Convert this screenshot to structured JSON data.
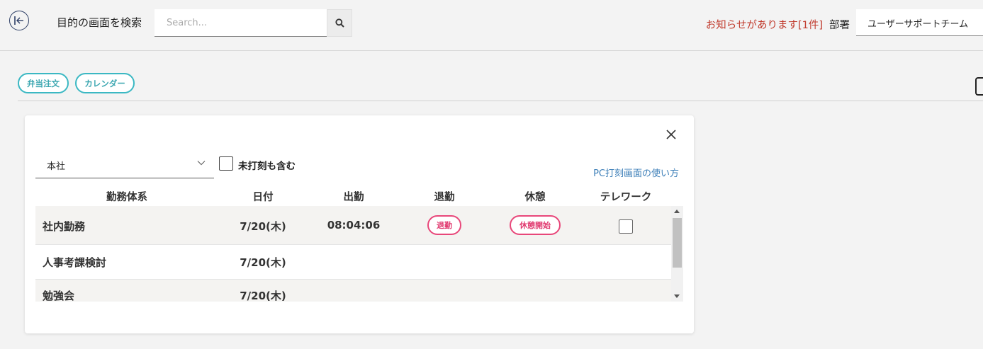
{
  "header": {
    "search_label": "目的の画面を検索",
    "search_placeholder": "Search...",
    "notice": "お知らせがあります[1件]",
    "dept_label": "部署",
    "dept_value": "ユーザーサポートチーム"
  },
  "tags": [
    {
      "label": "弁当注文"
    },
    {
      "label": "カレンダー"
    }
  ],
  "panel": {
    "office_value": "本社",
    "include_unpunched_label": "未打刻も含む",
    "howto_link": "PC打刻画面の使い方",
    "columns": [
      "勤務体系",
      "日付",
      "出勤",
      "退勤",
      "休憩",
      "テレワーク"
    ],
    "rows": [
      {
        "work_type": "社内勤務",
        "date": "7/20(木)",
        "clock_in": "08:04:06",
        "clock_out_button": "退勤",
        "break_button": "休憩開始"
      },
      {
        "work_type": "人事考課検討",
        "date": "7/20(木)"
      },
      {
        "work_type": "勉強会",
        "date": "7/20(木)"
      }
    ]
  },
  "colors": {
    "accent_teal": "#3bb8c3",
    "notice_red": "#c0392b",
    "pill_pink": "#e8477a",
    "link_blue": "#3d7fb8"
  }
}
